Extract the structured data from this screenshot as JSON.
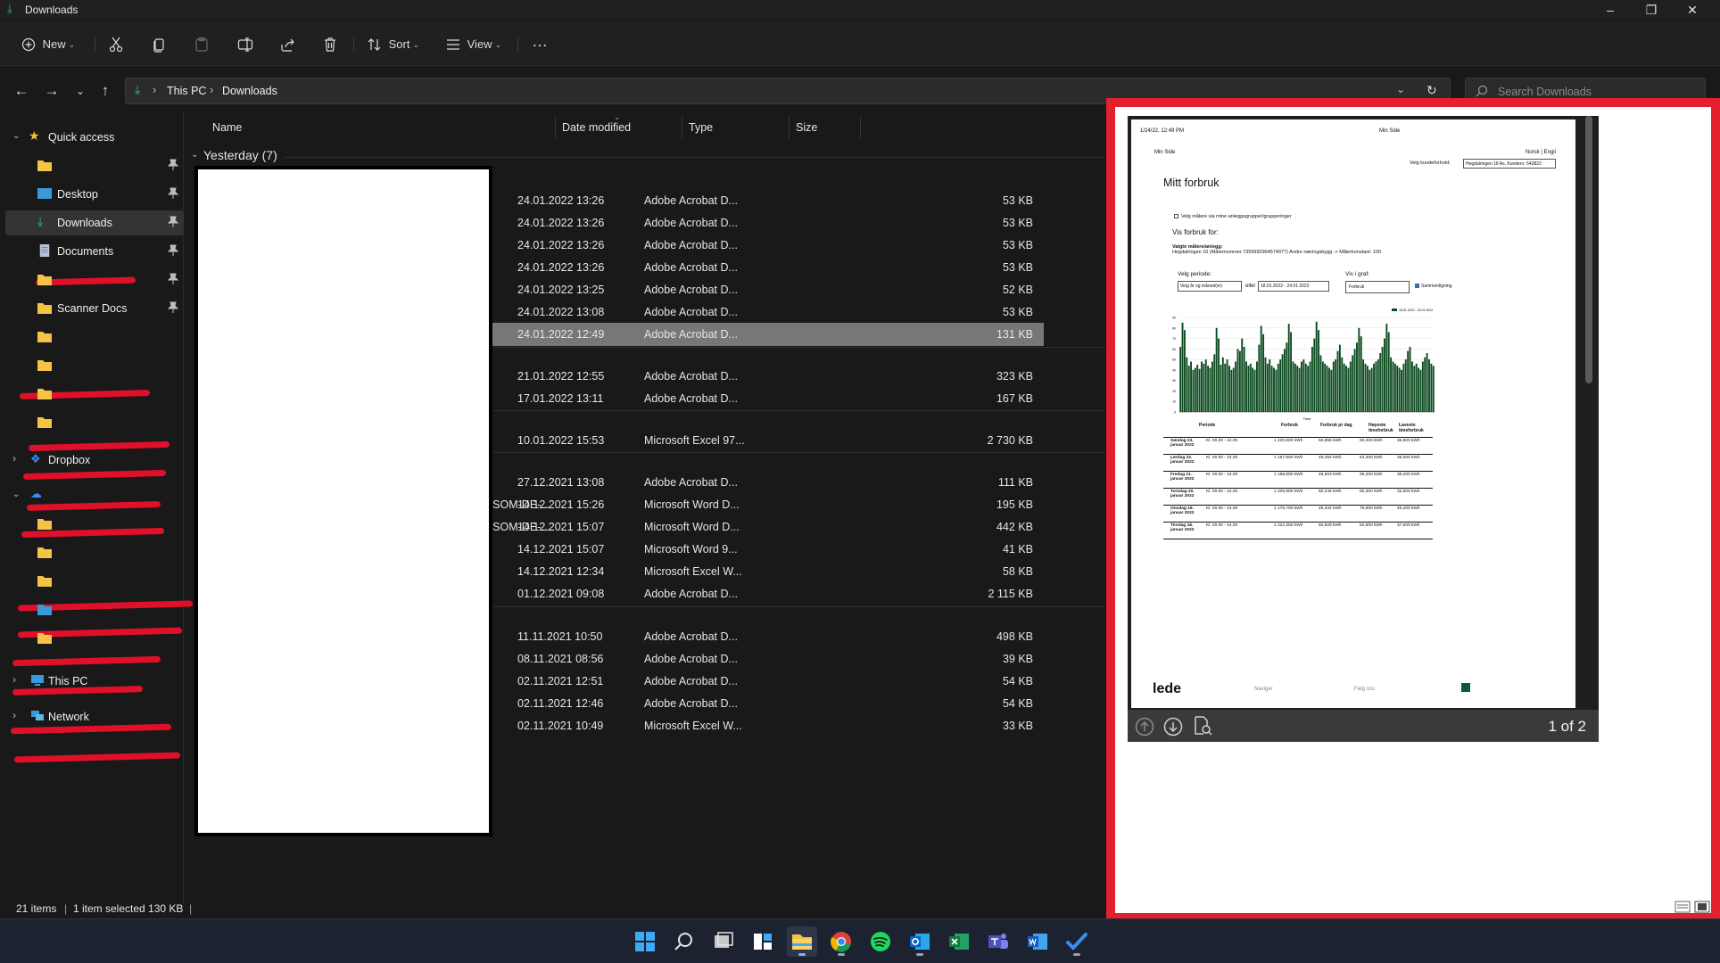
{
  "window": {
    "title": "Downloads"
  },
  "toolbar": {
    "new_label": "New",
    "sort_label": "Sort",
    "view_label": "View",
    "more_label": "…"
  },
  "address": {
    "crumb1": "This PC",
    "crumb2": "Downloads",
    "search_placeholder": "Search Downloads"
  },
  "sidebar": {
    "quick_access": "Quick access",
    "desktop": "Desktop",
    "downloads": "Downloads",
    "documents": "Documents",
    "scanner_docs": "Scanner Docs",
    "dropbox": "Dropbox",
    "this_pc": "This PC",
    "network": "Network"
  },
  "list": {
    "headers": {
      "name": "Name",
      "date": "Date modified",
      "type": "Type",
      "size": "Size"
    },
    "group": "Yesterday (7)",
    "rows": [
      {
        "name": "",
        "date": "24.01.2022 13:26",
        "type": "Adobe Acrobat D...",
        "size": "53 KB"
      },
      {
        "name": "",
        "date": "24.01.2022 13:26",
        "type": "Adobe Acrobat D...",
        "size": "53 KB"
      },
      {
        "name": "",
        "date": "24.01.2022 13:26",
        "type": "Adobe Acrobat D...",
        "size": "53 KB"
      },
      {
        "name": "",
        "date": "24.01.2022 13:26",
        "type": "Adobe Acrobat D...",
        "size": "53 KB"
      },
      {
        "name": "",
        "date": "24.01.2022 13:25",
        "type": "Adobe Acrobat D...",
        "size": "52 KB"
      },
      {
        "name": "",
        "date": "24.01.2022 13:08",
        "type": "Adobe Acrobat D...",
        "size": "53 KB"
      },
      {
        "name": "",
        "date": "24.01.2022 12:49",
        "type": "Adobe Acrobat D...",
        "size": "131 KB"
      },
      {
        "name": "",
        "date": "21.01.2022 12:55",
        "type": "Adobe Acrobat D...",
        "size": "323 KB"
      },
      {
        "name": "",
        "date": "17.01.2022 13:11",
        "type": "Adobe Acrobat D...",
        "size": "167 KB"
      },
      {
        "name": "",
        "date": "10.01.2022 15:53",
        "type": "Microsoft Excel 97...",
        "size": "2 730 KB"
      },
      {
        "name": "",
        "date": "27.12.2021 13:08",
        "type": "Adobe Acrobat D...",
        "size": "111 KB"
      },
      {
        "name": "-SOM-DE-...",
        "date": "14.12.2021 15:26",
        "type": "Microsoft Word D...",
        "size": "195 KB"
      },
      {
        "name": "-SOM-DE-...",
        "date": "14.12.2021 15:07",
        "type": "Microsoft Word D...",
        "size": "442 KB"
      },
      {
        "name": "",
        "date": "14.12.2021 15:07",
        "type": "Microsoft Word 9...",
        "size": "41 KB"
      },
      {
        "name": "",
        "date": "14.12.2021 12:34",
        "type": "Microsoft Excel W...",
        "size": "58 KB"
      },
      {
        "name": "",
        "date": "01.12.2021 09:08",
        "type": "Adobe Acrobat D...",
        "size": "2 115 KB"
      },
      {
        "name": "",
        "date": "11.11.2021 10:50",
        "type": "Adobe Acrobat D...",
        "size": "498 KB"
      },
      {
        "name": "",
        "date": "08.11.2021 08:56",
        "type": "Adobe Acrobat D...",
        "size": "39 KB"
      },
      {
        "name": "",
        "date": "02.11.2021 12:51",
        "type": "Adobe Acrobat D...",
        "size": "54 KB"
      },
      {
        "name": "",
        "date": "02.11.2021 12:46",
        "type": "Adobe Acrobat D...",
        "size": "54 KB"
      },
      {
        "name": "",
        "date": "02.11.2021 10:49",
        "type": "Microsoft Excel W...",
        "size": "33 KB"
      }
    ],
    "selected_index": 6
  },
  "status": {
    "items": "21 items",
    "selected": "1 item selected  130 KB"
  },
  "preview": {
    "page_indicator": "1 of 2",
    "doc": {
      "header_date": "1/24/22, 12:49 PM",
      "header_center": "Min Side",
      "min_side": "Min Side",
      "lang": "Norsk | Engli",
      "velg_kunde_label": "Velg kundeforhold:",
      "velg_kunde_value": "Hegdalringen 18 As, Kundenr: 543822",
      "heading": "Mitt forbruk",
      "checkbox_label": "Velg målere via mine anleggsgrupper/grupperinger",
      "vis_for": "Vis forbruk for:",
      "valgte_label": "Valgte målere/anlegg:",
      "valgte_value": "Hegdalringen 10 (Målernummer 7359992904574977) Andre næringsbygg -> Målerkonstant: 100",
      "periode_label": "Velg periode:",
      "periode_select": "Velg år og måned(er)",
      "eller": "eller",
      "date_range": "18.01.2022 - 24.01.2022",
      "vis_graf": "Vis i graf:",
      "graf_select": "Forbruk",
      "sammenligning": "Sammenligning",
      "legend": "18.01.2022 - 24.01.2022",
      "xaxis": "Time",
      "table_headers": [
        "Periode",
        "Forbruk",
        "Forbruk pr dag",
        "Høyeste timeforbruk",
        "Laveste timeforbruk"
      ],
      "table_rows": [
        [
          "Søndag 23. januar 2022",
          "Kl. 00.00 - 24.00",
          "1 220,600 kWh",
          "50,858 kWh",
          "60,400 kWh",
          "36,800 kWh"
        ],
        [
          "Lørdag 22. januar 2022",
          "Kl. 00.00 - 24.00",
          "1 187,800 kWh",
          "49,492 kWh",
          "63,300 kWh",
          "36,500 kWh"
        ],
        [
          "Fredag 21. januar 2022",
          "Kl. 00.00 - 24.00",
          "1 188,600 kWh",
          "49,563 kWh",
          "65,200 kWh",
          "36,400 kWh"
        ],
        [
          "Torsdag 20. januar 2022",
          "Kl. 00.00 - 24.00",
          "1 205,900 kWh",
          "50,246 kWh",
          "85,300 kWh",
          "32,600 kWh"
        ],
        [
          "Onsdag 19. januar 2022",
          "Kl. 00.00 - 24.00",
          "1 176,700 kWh",
          "49,334 kWh",
          "76,600 kWh",
          "40,400 kWh"
        ],
        [
          "Tirsdag 18. januar 2022",
          "Kl. 00.00 - 24.00",
          "1 222,300 kWh",
          "50,929 kWh",
          "84,600 kWh",
          "37,600 kWh"
        ]
      ],
      "footer_logo": "lede",
      "footer_nav": "Naviger",
      "footer_follow": "Følg oss"
    }
  },
  "chart_data": {
    "type": "bar",
    "xlabel": "Time",
    "ylim": [
      0,
      90
    ],
    "yticks": [
      0,
      10,
      20,
      30,
      40,
      50,
      60,
      70,
      80,
      90
    ],
    "series": [
      {
        "name": "18.01.2022 - 24.01.2022",
        "values": [
          62,
          85,
          78,
          52,
          44,
          48,
          40,
          42,
          45,
          41,
          48,
          46,
          50,
          44,
          42,
          48,
          55,
          80,
          70,
          45,
          52,
          46,
          50,
          44,
          40,
          42,
          48,
          60,
          58,
          70,
          62,
          48,
          44,
          46,
          42,
          40,
          48,
          64,
          82,
          74,
          52,
          46,
          50,
          44,
          42,
          40,
          46,
          50,
          55,
          60,
          66,
          84,
          76,
          48,
          46,
          44,
          42,
          48,
          50,
          46,
          44,
          48,
          62,
          70,
          86,
          78,
          54,
          48,
          46,
          44,
          42,
          40,
          48,
          50,
          58,
          64,
          52,
          46,
          44,
          42,
          48,
          54,
          60,
          66,
          80,
          72,
          50,
          46,
          44,
          40,
          42,
          46,
          48,
          50,
          56,
          62,
          70,
          84,
          76,
          52,
          48,
          46,
          44,
          42,
          40,
          46,
          50,
          58,
          62,
          48,
          44,
          46,
          42,
          40,
          48,
          52,
          56,
          50,
          46,
          44
        ]
      }
    ]
  },
  "taskbar": {
    "apps": [
      "windows-start",
      "search",
      "task-view",
      "widgets",
      "file-explorer",
      "chrome",
      "spotify",
      "outlook",
      "excel",
      "teams",
      "word",
      "todo"
    ]
  }
}
